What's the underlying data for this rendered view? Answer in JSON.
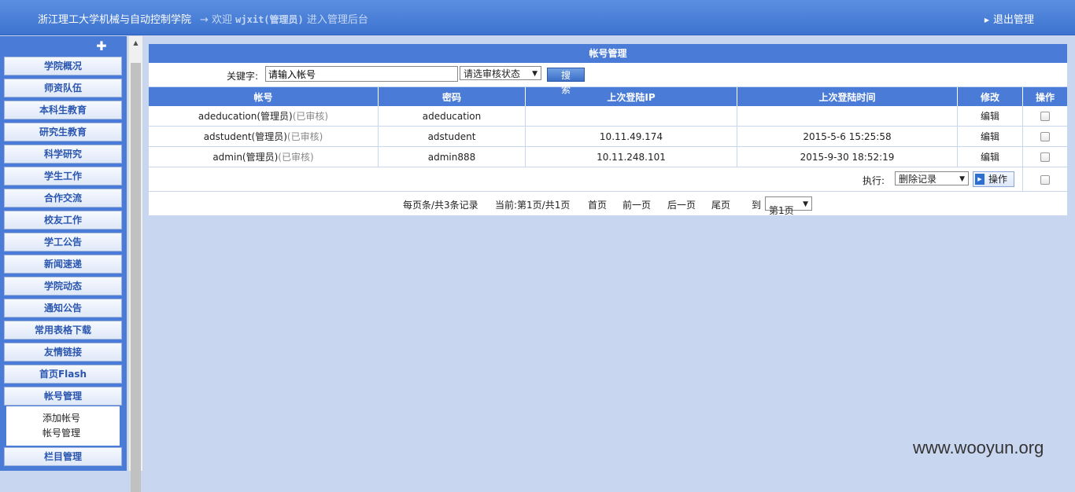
{
  "header": {
    "site_name": "浙江理工大学机械与自动控制学院",
    "welcome_prefix": "→ 欢迎 ",
    "username": "wjxit(管理员)",
    "welcome_suffix": " 进入管理后台",
    "logout": "退出管理"
  },
  "sidebar": {
    "items": [
      {
        "label": "学院概况"
      },
      {
        "label": "师资队伍"
      },
      {
        "label": "本科生教育"
      },
      {
        "label": "研究生教育"
      },
      {
        "label": "科学研究"
      },
      {
        "label": "学生工作"
      },
      {
        "label": "合作交流"
      },
      {
        "label": "校友工作"
      },
      {
        "label": "学工公告"
      },
      {
        "label": "新闻速递"
      },
      {
        "label": "学院动态"
      },
      {
        "label": "通知公告"
      },
      {
        "label": "常用表格下载"
      },
      {
        "label": "友情链接"
      },
      {
        "label": "首页Flash"
      },
      {
        "label": "帐号管理"
      },
      {
        "label": "栏目管理"
      }
    ],
    "submenu": [
      "添加帐号",
      "帐号管理"
    ]
  },
  "panel": {
    "title": "帐号管理",
    "search": {
      "keyword_label": "关键字:",
      "keyword_value": "请输入帐号",
      "status_select": "请选审核状态",
      "search_button": "搜 索"
    },
    "table": {
      "headers": [
        "帐号",
        "密码",
        "上次登陆IP",
        "上次登陆时间",
        "修改",
        "操作"
      ],
      "rows": [
        {
          "account": "adeducation(管理员)",
          "status": "(已审核)",
          "password": "adeducation",
          "ip": "",
          "time": "",
          "edit": "编辑"
        },
        {
          "account": "adstudent(管理员)",
          "status": "(已审核)",
          "password": "adstudent",
          "ip": "10.11.49.174",
          "time": "2015-5-6 15:25:58",
          "edit": "编辑"
        },
        {
          "account": "admin(管理员)",
          "status": "(已审核)",
          "password": "admin888",
          "ip": "10.11.248.101",
          "time": "2015-9-30 18:52:19",
          "edit": "编辑"
        }
      ]
    },
    "execute": {
      "label": "执行:",
      "select": "删除记录",
      "button": "操作"
    },
    "pager": {
      "per_page": "每页条/共3条记录",
      "current": "当前:第1页/共1页",
      "first": "首页",
      "prev": "前一页",
      "next": "后一页",
      "last": "尾页",
      "goto": "到",
      "page_select": "第1页"
    }
  },
  "watermark": "www.wooyun.org"
}
